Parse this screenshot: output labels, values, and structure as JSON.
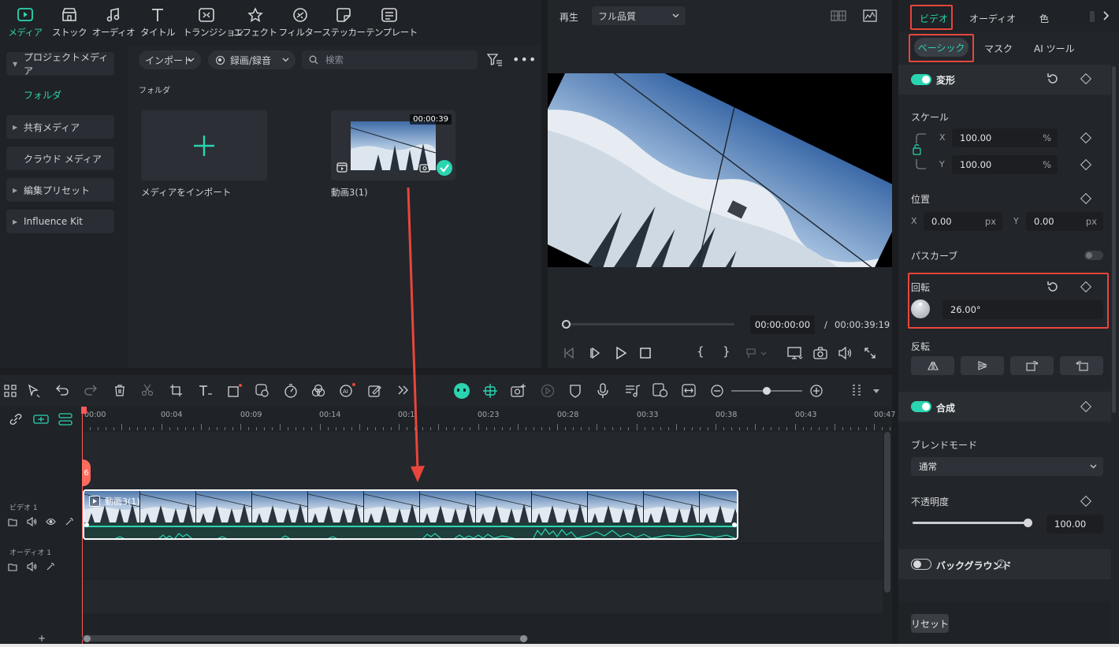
{
  "top_toolbar": {
    "items": [
      {
        "label": "メディア",
        "icon": "media-icon"
      },
      {
        "label": "ストック",
        "icon": "stock-icon"
      },
      {
        "label": "オーディオ",
        "icon": "audio-note-icon"
      },
      {
        "label": "タイトル",
        "icon": "title-t-icon"
      },
      {
        "label": "トランジション",
        "icon": "transition-icon"
      },
      {
        "label": "エフェクト",
        "icon": "effect-star-icon"
      },
      {
        "label": "フィルター",
        "icon": "filter-icon"
      },
      {
        "label": "ステッカー",
        "icon": "sticker-icon"
      },
      {
        "label": "テンプレート",
        "icon": "template-icon"
      }
    ]
  },
  "sidebar": {
    "items": [
      {
        "label": "プロジェクトメディア"
      },
      {
        "label": "フォルダ"
      },
      {
        "label": "共有メディア"
      },
      {
        "label": "クラウド メディア"
      },
      {
        "label": "編集プリセット"
      },
      {
        "label": "Influence Kit"
      }
    ]
  },
  "media_bar": {
    "import_label": "インポート",
    "record_label": "録画/録音",
    "search_placeholder": "検索",
    "folder_heading": "フォルダ"
  },
  "media_items": [
    {
      "name": "メディアをインポート"
    },
    {
      "name": "動画3(1)",
      "duration": "00:00:39"
    }
  ],
  "preview": {
    "play_label": "再生",
    "quality": "フル品質",
    "current_time": "00:00:00:00",
    "separator": "/",
    "total_time": "00:00:39:19"
  },
  "timeline": {
    "ticks": [
      "00:00",
      "00:04",
      "00:09",
      "00:14",
      "00:1",
      "00:23",
      "00:28",
      "00:33",
      "00:38",
      "00:43",
      "00:47"
    ],
    "video_track_label": "ビデオ 1",
    "audio_track_label": "オーディオ 1",
    "clip_label": "動画3(1)",
    "playhead_badge": "6",
    "add_track": "+"
  },
  "right_panel": {
    "tabs": [
      "ビデオ",
      "オーディオ",
      "色"
    ],
    "subtabs": [
      "ベーシック",
      "マスク",
      "AI ツール"
    ],
    "transform": {
      "title": "変形",
      "scale_label": "スケール",
      "scale_x_axis": "X",
      "scale_x": "100.00",
      "scale_y_axis": "Y",
      "scale_y": "100.00",
      "percent": "%",
      "position_label": "位置",
      "pos_x_axis": "X",
      "pos_x": "0.00",
      "pos_y_axis": "Y",
      "pos_y": "0.00",
      "px": "px",
      "path_curve_label": "パスカーブ",
      "rotation_label": "回転",
      "rotation_value": "26.00°",
      "flip_label": "反転"
    },
    "composite": {
      "title": "合成",
      "blend_label": "ブレンドモード",
      "blend_value": "通常",
      "opacity_label": "不透明度",
      "opacity_value": "100.00",
      "opacity_fraction": 1.0
    },
    "background": {
      "title": "バックグラウンド"
    },
    "reset_label": "リセット"
  },
  "colors": {
    "accent": "#2bd4b0",
    "highlight": "#e8463b",
    "playhead": "#ff5a5a"
  }
}
